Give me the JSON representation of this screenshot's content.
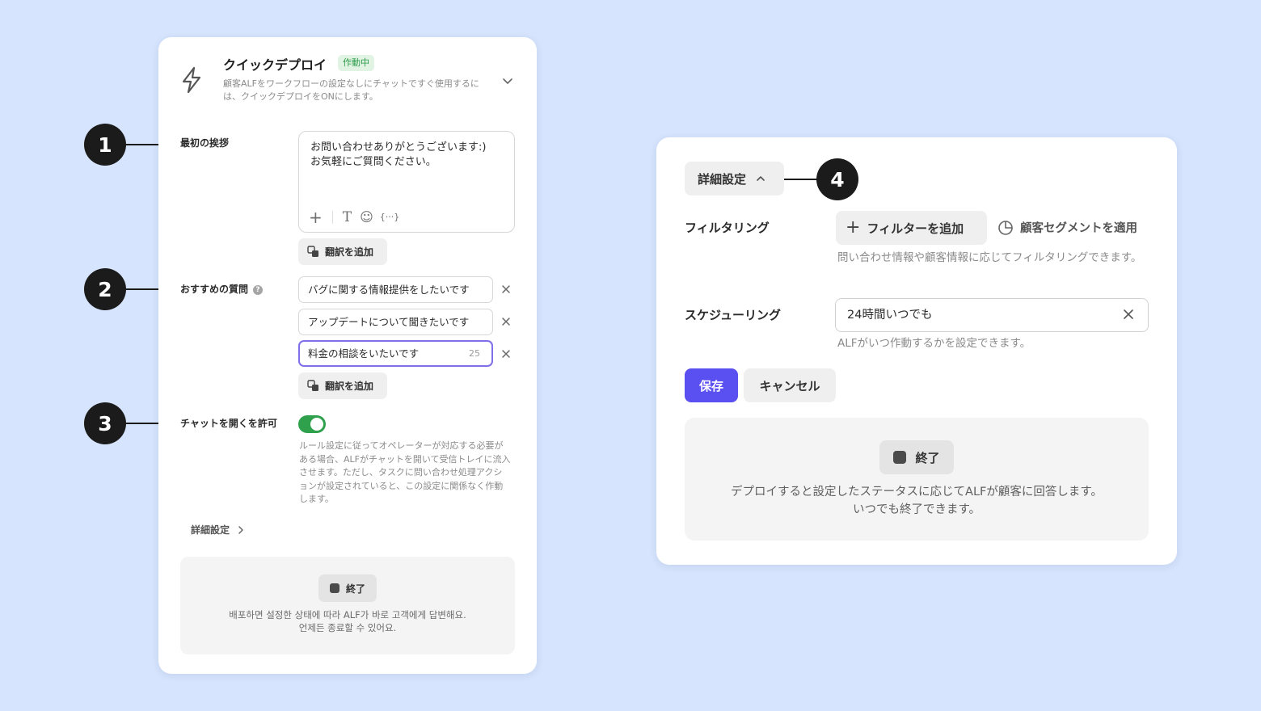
{
  "markers": [
    "1",
    "2",
    "3",
    "4"
  ],
  "quick_deploy": {
    "title": "クイックデプロイ",
    "status_badge": "作動中",
    "description": "顧客ALFをワークフローの設定なしにチャットですぐ使用するには、クイックデプロイをONにします。",
    "greeting": {
      "label": "最初の挨拶",
      "text": "お問い合わせありがとうございます:)\nお気軽にご質問ください。",
      "add_translation": "翻訳を追加"
    },
    "suggested_questions": {
      "label": "おすすめの質問",
      "items": [
        "バグに関する情報提供をしたいです",
        "アップデートについて聞きたいです",
        "料金の相談をいたいです"
      ],
      "char_count": "25",
      "add_translation": "翻訳を追加"
    },
    "allow_open_chat": {
      "label": "チャットを開くを許可",
      "enabled": true,
      "description": "ルール設定に従ってオペレーターが対応する必要がある場合、ALFがチャットを開いて受信トレイに流入させます。ただし、タスクに問い合わせ処理アクションが設定されていると、この設定に関係なく作動します。"
    },
    "advanced_link": "詳細設定",
    "stop_button": "終了",
    "deploy_note": "배포하면 설정한 상태에 따라 ALF가 바로 고객에게 답변해요.\n언제든 종료할 수 있어요."
  },
  "advanced_settings": {
    "header": "詳細設定",
    "filtering": {
      "label": "フィルタリング",
      "add_filter": "フィルターを追加",
      "apply_segment": "顧客セグメントを適用",
      "hint": "問い合わせ情報や顧客情報に応じてフィルタリングできます。"
    },
    "scheduling": {
      "label": "スケジューリング",
      "value": "24時間いつでも",
      "hint": "ALFがいつ作動するかを設定できます。"
    },
    "save": "保存",
    "cancel": "キャンセル",
    "stop_button": "終了",
    "deploy_note": "デプロイすると設定したステータスに応じてALFが顧客に回答します。\nいつでも終了できます。"
  },
  "colors": {
    "background": "#d6e4fd",
    "accent": "#5a4ff0",
    "toggle_on": "#2fa14c",
    "badge_bg": "#e1f4e4",
    "badge_text": "#2b9a4a"
  }
}
